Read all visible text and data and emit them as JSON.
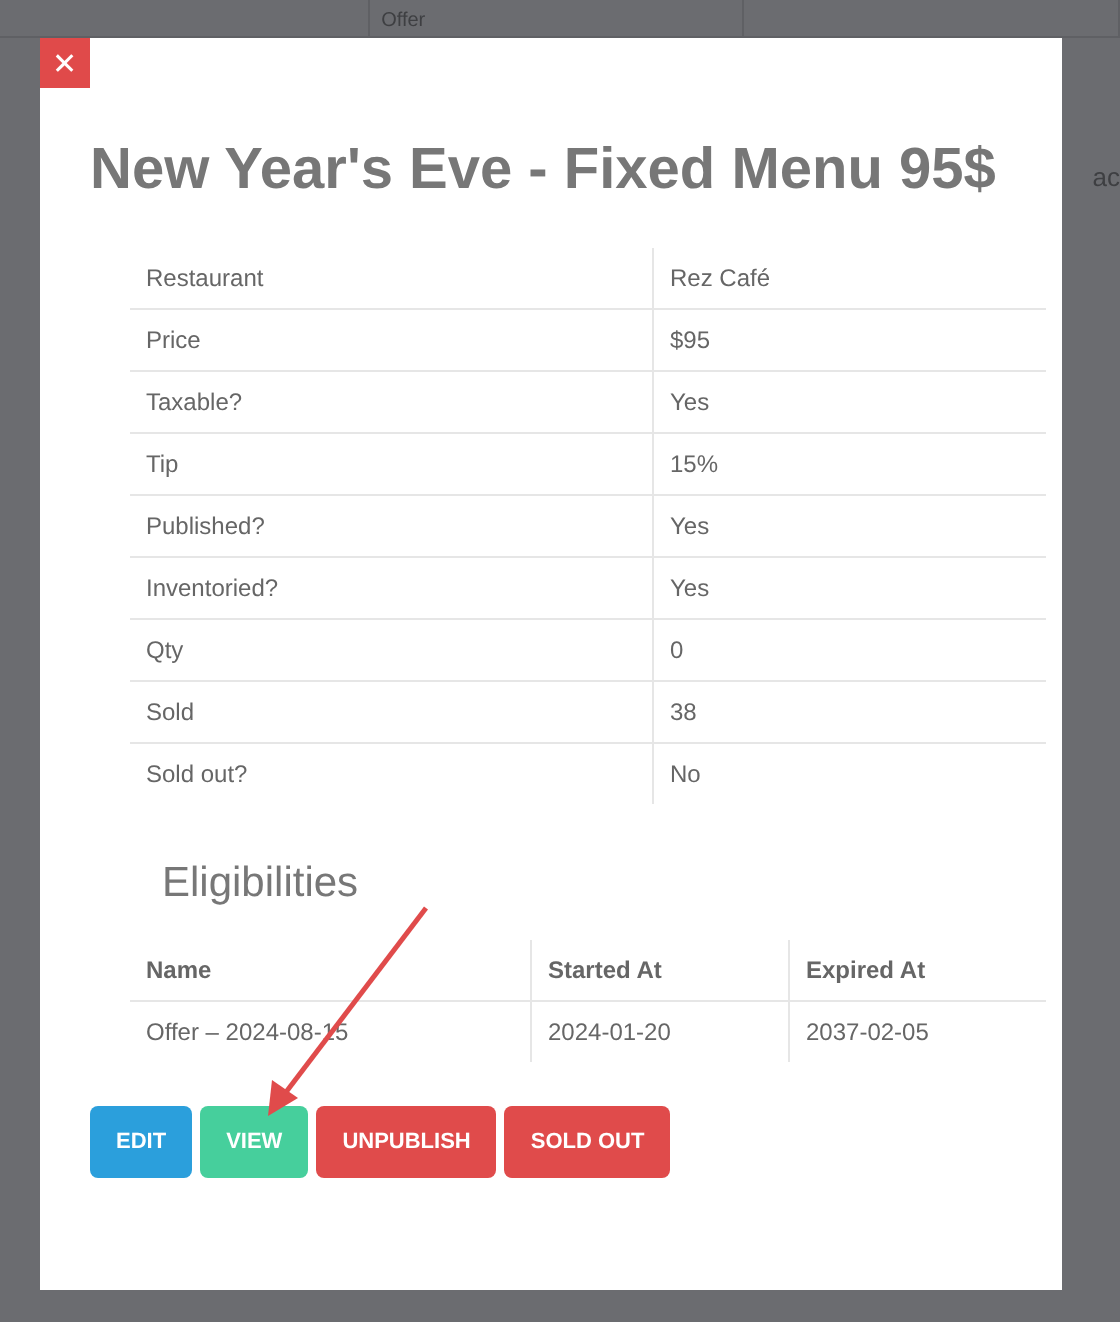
{
  "background": {
    "column_header": "Offer",
    "side_text": "ac"
  },
  "modal": {
    "title": "New Year's Eve - Fixed Menu 95$",
    "close_label": "✕",
    "details": [
      {
        "label": "Restaurant",
        "value": "Rez Café"
      },
      {
        "label": "Price",
        "value": "$95"
      },
      {
        "label": "Taxable?",
        "value": "Yes"
      },
      {
        "label": "Tip",
        "value": "15%"
      },
      {
        "label": "Published?",
        "value": "Yes"
      },
      {
        "label": "Inventoried?",
        "value": "Yes"
      },
      {
        "label": "Qty",
        "value": "0"
      },
      {
        "label": "Sold",
        "value": "38"
      },
      {
        "label": "Sold out?",
        "value": "No"
      }
    ],
    "eligibilities": {
      "heading": "Eligibilities",
      "columns": [
        "Name",
        "Started At",
        "Expired At"
      ],
      "rows": [
        [
          "Offer – 2024-08-15",
          "2024-01-20",
          "2037-02-05"
        ]
      ]
    },
    "buttons": [
      {
        "label": "EDIT",
        "kind": "primary"
      },
      {
        "label": "VIEW",
        "kind": "success"
      },
      {
        "label": "UNPUBLISH",
        "kind": "danger"
      },
      {
        "label": "SOLD OUT",
        "kind": "danger"
      }
    ]
  }
}
